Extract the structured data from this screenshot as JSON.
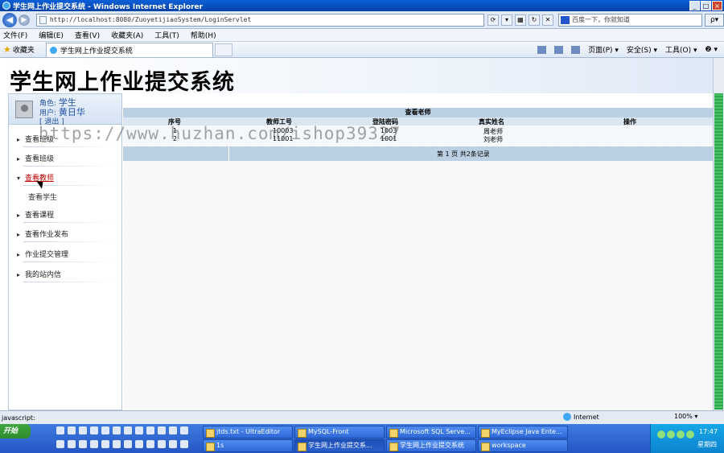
{
  "window": {
    "title": "学生网上作业提交系统 - Windows Internet Explorer",
    "buttons": [
      "_",
      "□",
      "×"
    ]
  },
  "addressbar": {
    "url": "http://localhost:8080/ZuoyetijiaoSystem/LoginServlet",
    "search_placeholder": "百度一下，你就知道",
    "search_go": "ρ▾"
  },
  "menubar": {
    "items": [
      "文件(F)",
      "编辑(E)",
      "查看(V)",
      "收藏夹(A)",
      "工具(T)",
      "帮助(H)"
    ]
  },
  "tabbar": {
    "favorites": "收藏夹",
    "tab_title": "学生网上作业提交系统",
    "commands": [
      "页面(P) ▾",
      "安全(S) ▾",
      "工具(O) ▾",
      "❷ ▾"
    ]
  },
  "page": {
    "system_title": "学生网上作业提交系统",
    "user": {
      "role_label": "角色:",
      "role_value": "学生",
      "user_label": "用户:",
      "user_value": "黄日华",
      "logout": "[ 退出 ]"
    },
    "nav": {
      "items": [
        {
          "label": "查看班级"
        },
        {
          "label": "查看班级"
        },
        {
          "label": "查看教师"
        },
        {
          "label": "查看课程"
        },
        {
          "label": "查看作业发布"
        },
        {
          "label": "作业提交管理"
        },
        {
          "label": "我的站内信"
        }
      ],
      "sub_item": "查看学生"
    },
    "table": {
      "title": "查看老师",
      "columns": [
        "序号",
        "教师工号",
        "登陆密码",
        "真实姓名",
        "操作"
      ],
      "rows": [
        [
          "1",
          "10003",
          "1003",
          "周老师",
          ""
        ],
        [
          "2",
          "11001",
          "1001",
          "刘老师",
          ""
        ]
      ],
      "pager": "第 1 页   共2条记录"
    },
    "watermark": "https://www.huzhan.com/ishop39327"
  },
  "statusbar": {
    "left_text": "javascript:",
    "zone": "Internet",
    "zoom": "100% ▾"
  },
  "taskbar": {
    "start": "开始",
    "tasks": [
      "jtds.txt - UltraEditor",
      "MySQL-Front",
      "Microsoft SQL Serve...",
      "MyEclipse Java Ente...",
      "1s",
      "学生网上作业提交系...",
      "学生网上作业提交系统",
      "workspace"
    ],
    "clock": "17:47",
    "day": "星期四"
  }
}
